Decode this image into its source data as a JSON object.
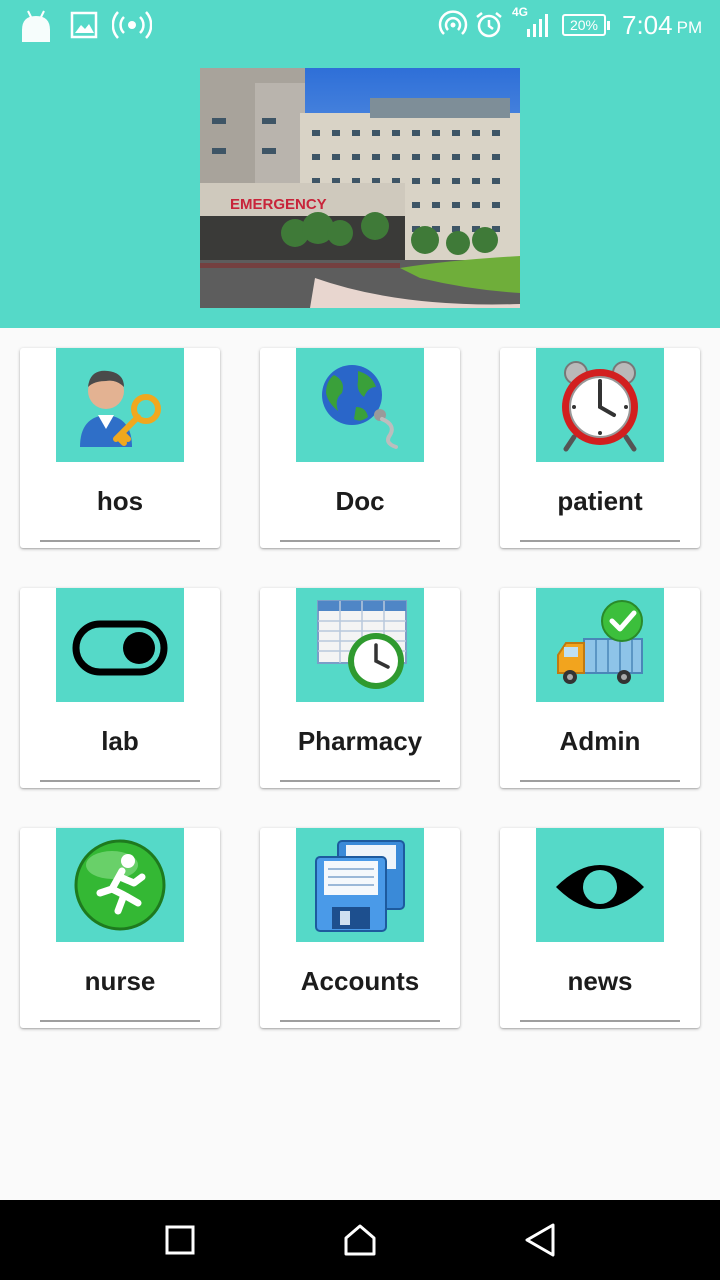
{
  "status_bar": {
    "network_type": "4G",
    "battery_percent": "20%",
    "time": "7:04",
    "time_suffix": "PM",
    "icons": [
      "android-icon",
      "image-icon",
      "hotspot-icon",
      "wifi-calling-icon",
      "alarm-icon",
      "signal-icon",
      "battery-icon"
    ]
  },
  "header": {
    "image_sign_text": "EMERGENCY"
  },
  "menu": [
    {
      "label": "hos",
      "icon": "user-key-icon"
    },
    {
      "label": "Doc",
      "icon": "globe-plug-icon"
    },
    {
      "label": "patient",
      "icon": "alarm-clock-icon"
    },
    {
      "label": "lab",
      "icon": "toggle-icon"
    },
    {
      "label": "Pharmacy",
      "icon": "schedule-clock-icon"
    },
    {
      "label": "Admin",
      "icon": "delivery-truck-check-icon"
    },
    {
      "label": "nurse",
      "icon": "exit-runner-icon"
    },
    {
      "label": "Accounts",
      "icon": "floppy-disks-icon"
    },
    {
      "label": "news",
      "icon": "eye-icon"
    }
  ],
  "nav_bar": {
    "icons": [
      "recents-icon",
      "home-icon",
      "back-icon"
    ]
  },
  "colors": {
    "accent": "#55d9c8",
    "background": "#fafafa",
    "card": "#ffffff",
    "text": "#1c1c1c"
  }
}
